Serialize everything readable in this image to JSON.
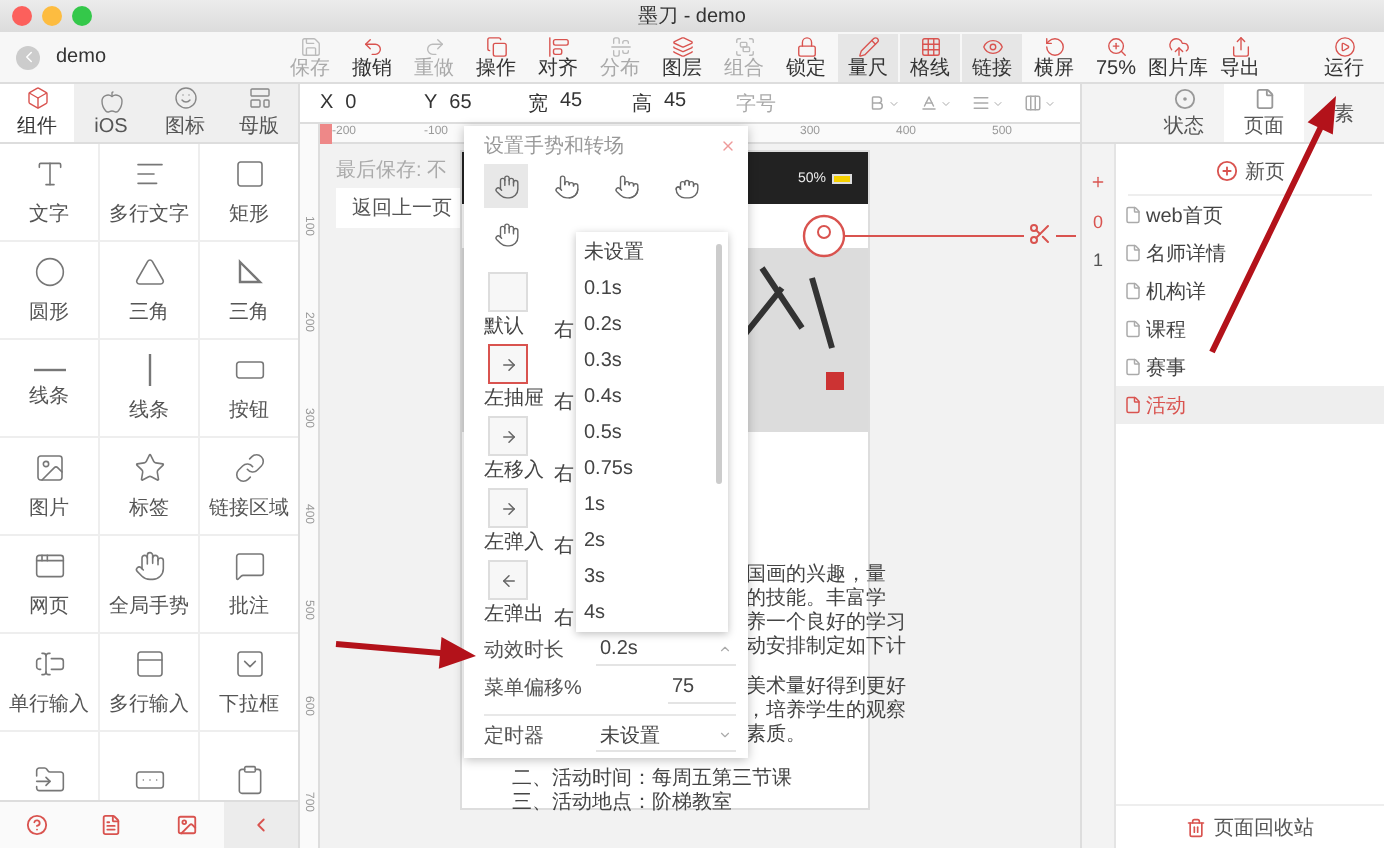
{
  "window": {
    "title": "墨刀 - demo"
  },
  "project": "demo",
  "toolbar": [
    {
      "label": "保存",
      "disabled": true,
      "active": false
    },
    {
      "label": "撤销",
      "disabled": false,
      "active": false
    },
    {
      "label": "重做",
      "disabled": true,
      "active": false
    },
    {
      "label": "操作",
      "disabled": false,
      "active": false
    },
    {
      "label": "对齐",
      "disabled": false,
      "active": false
    },
    {
      "label": "分布",
      "disabled": true,
      "active": false
    },
    {
      "label": "图层",
      "disabled": false,
      "active": false
    },
    {
      "label": "组合",
      "disabled": true,
      "active": false
    },
    {
      "label": "锁定",
      "disabled": false,
      "active": false
    },
    {
      "label": "量尺",
      "disabled": false,
      "active": true
    },
    {
      "label": "格线",
      "disabled": false,
      "active": true
    },
    {
      "label": "链接",
      "disabled": false,
      "active": true
    },
    {
      "label": "横屏",
      "disabled": false,
      "active": false
    },
    {
      "label": "75%",
      "disabled": false,
      "active": false
    },
    {
      "label": "图片库",
      "disabled": false,
      "active": false
    },
    {
      "label": "导出",
      "disabled": false,
      "active": false
    },
    {
      "label": "运行",
      "disabled": false,
      "active": false
    }
  ],
  "left_tabs": [
    {
      "label": "组件",
      "selected": true
    },
    {
      "label": "iOS",
      "selected": false
    },
    {
      "label": "图标",
      "selected": false
    },
    {
      "label": "母版",
      "selected": false
    }
  ],
  "components": [
    "文字",
    "多行文字",
    "矩形",
    "圆形",
    "三角",
    "三角",
    "线条",
    "线条",
    "按钮",
    "图片",
    "标签",
    "链接区域",
    "网页",
    "全局手势",
    "批注",
    "单行输入",
    "多行输入",
    "下拉框"
  ],
  "properties": [
    {
      "label": "X",
      "value": "0"
    },
    {
      "label": "Y",
      "value": "65"
    },
    {
      "label": "宽",
      "value": "45"
    },
    {
      "label": "高",
      "value": "45"
    }
  ],
  "font_size": {
    "placeholder": "字号"
  },
  "right_tabs": [
    {
      "label": "状态",
      "selected": false
    },
    {
      "label": "页面",
      "selected": true
    },
    {
      "label": "素",
      "selected": false
    }
  ],
  "top_ruler": [
    "-200",
    "-100",
    "300",
    "400",
    "500"
  ],
  "left_ruler": [
    "100",
    "200",
    "300",
    "400",
    "500",
    "600",
    "700"
  ],
  "canvas": {
    "save_status": "最后保存: 不",
    "back_button": "返回上一页"
  },
  "phone": {
    "battery": "50%",
    "text_lines": [
      "国画的兴趣，量",
      "的技能。丰富学",
      "养一个良好的学习",
      "动安排制定如下计"
    ],
    "text_lines_2": [
      "美术量好得到更好",
      "，培养学生的观察",
      "素质。"
    ],
    "bottom_lines": [
      "二、活动时间：每周五第三节课",
      "三、活动地点：阶梯教室"
    ]
  },
  "popup": {
    "title": "设置手势和转场",
    "gestures": [
      {
        "selected": true
      },
      {
        "selected": false
      },
      {
        "selected": false
      },
      {
        "selected": false
      }
    ],
    "transitions": [
      {
        "label": "默认",
        "selected": false,
        "kind": "blank",
        "right": "右"
      },
      {
        "label": "左抽屉",
        "selected": true,
        "kind": "rightward",
        "right": "右"
      },
      {
        "label": "左移入",
        "selected": false,
        "kind": "rightward",
        "right": "右"
      },
      {
        "label": "左弹入",
        "selected": false,
        "kind": "rightward",
        "right": "右"
      },
      {
        "label": "左弹出",
        "selected": false,
        "kind": "leftward",
        "right": "右"
      }
    ],
    "duration_options": [
      "未设置",
      "0.1s",
      "0.2s",
      "0.3s",
      "0.4s",
      "0.5s",
      "0.75s",
      "1s",
      "2s",
      "3s",
      "4s"
    ],
    "fields": [
      {
        "label": "动效时长",
        "value": "0.2s",
        "kind": "select"
      },
      {
        "label": "菜单偏移%",
        "value": "75",
        "kind": "input"
      },
      {
        "label": "定时器",
        "value": "未设置",
        "kind": "select"
      }
    ]
  },
  "pages": {
    "numbers": [
      "0",
      "1"
    ],
    "new_page": "新页",
    "items": [
      {
        "label": "web首页",
        "selected": false
      },
      {
        "label": "名师详情",
        "selected": false
      },
      {
        "label": "机构详",
        "selected": false
      },
      {
        "label": "课程",
        "selected": false
      },
      {
        "label": "赛事",
        "selected": false
      },
      {
        "label": "活动",
        "selected": true
      }
    ],
    "recycle": "页面回收站"
  }
}
